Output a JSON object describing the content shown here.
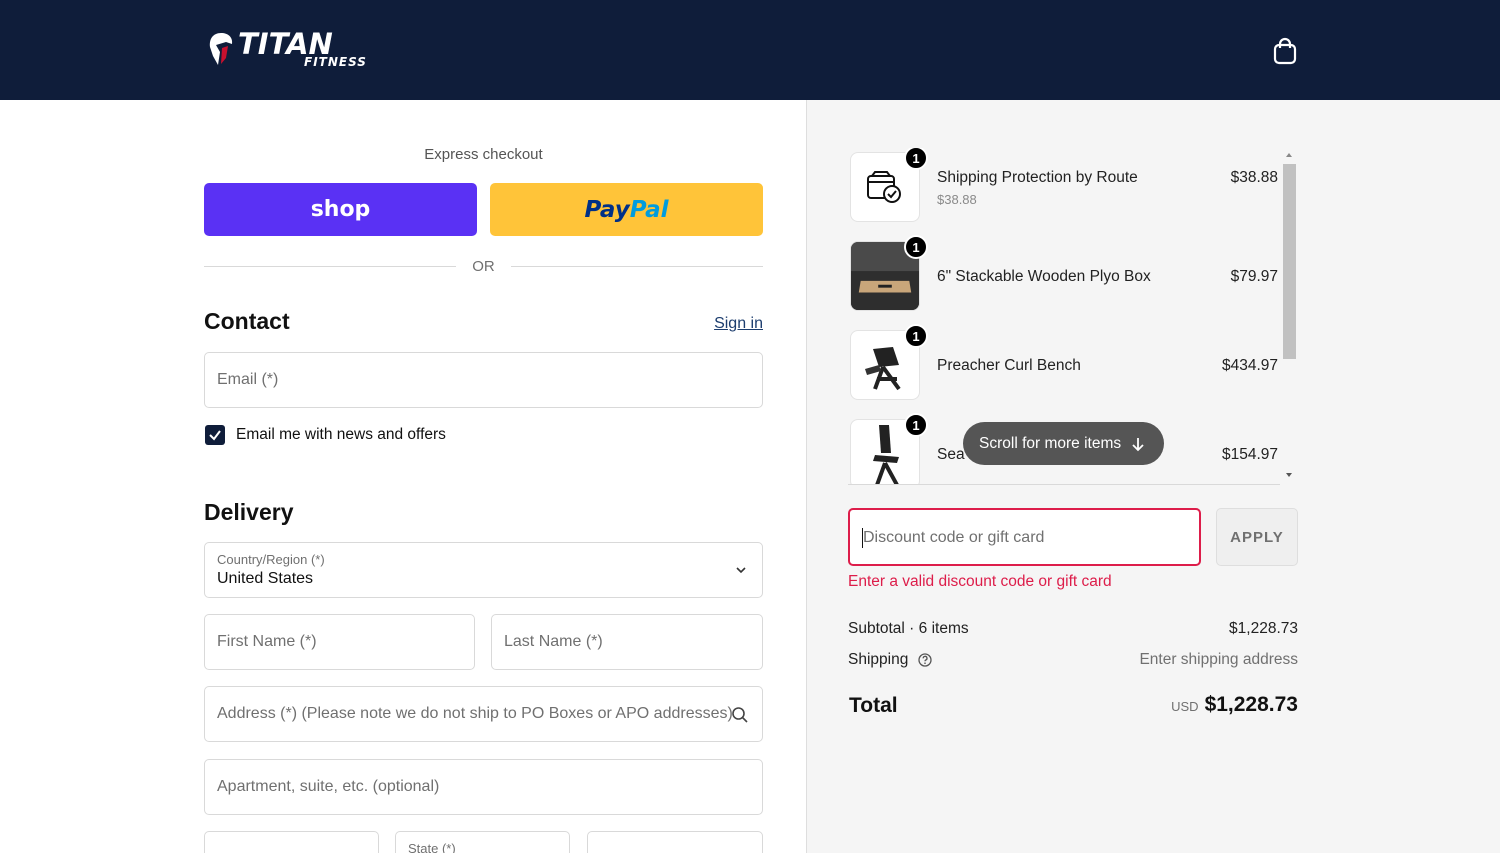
{
  "brand": {
    "name": "TITAN",
    "sub": "FITNESS"
  },
  "express": {
    "label": "Express checkout",
    "shop_label": "shop",
    "paypal_part1": "Pay",
    "paypal_part2": "Pal",
    "or_label": "OR"
  },
  "contact": {
    "heading": "Contact",
    "signin": "Sign in",
    "email_placeholder": "Email (*)",
    "newsletter_label": "Email me with news and offers",
    "newsletter_checked": true
  },
  "delivery": {
    "heading": "Delivery",
    "country_label": "Country/Region (*)",
    "country_value": "United States",
    "first_name_placeholder": "First Name (*)",
    "last_name_placeholder": "Last Name (*)",
    "address_placeholder": "Address (*) (Please note we do not ship to PO Boxes or APO addresses)",
    "apartment_placeholder": "Apartment, suite, etc. (optional)",
    "state_label": "State (*)"
  },
  "cart": {
    "items": [
      {
        "name": "Shipping Protection by Route",
        "sub": "$38.88",
        "price": "$38.88",
        "qty": "1",
        "icon": "shipping-protection-icon"
      },
      {
        "name": "6\" Stackable Wooden Plyo Box",
        "sub": "",
        "price": "$79.97",
        "qty": "1",
        "icon": "plyo-box-image"
      },
      {
        "name": "Preacher Curl Bench",
        "sub": "",
        "price": "$434.97",
        "qty": "1",
        "icon": "curl-bench-image"
      },
      {
        "name": "Sea",
        "sub": "",
        "price": "$154.97",
        "qty": "1",
        "icon": "seat-bench-image"
      }
    ],
    "scroll_hint": "Scroll for more items"
  },
  "discount": {
    "placeholder": "Discount code or gift card",
    "apply_label": "APPLY",
    "error": "Enter a valid discount code or gift card"
  },
  "summary": {
    "subtotal_label": "Subtotal · 6 items",
    "subtotal_value": "$1,228.73",
    "shipping_label": "Shipping",
    "shipping_value": "Enter shipping address",
    "total_label": "Total",
    "currency": "USD",
    "total_value": "$1,228.73"
  },
  "colors": {
    "header_bg": "#0f1d3a",
    "shop_purple": "#5a31f4",
    "paypal_yellow": "#ffc439",
    "error_red": "#dd1d4a"
  }
}
